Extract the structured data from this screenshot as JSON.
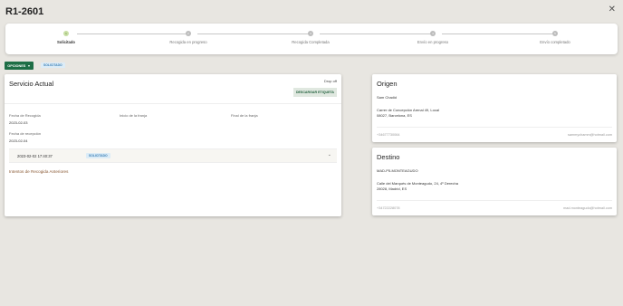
{
  "header": {
    "title": "R1-2601",
    "close_icon": "close-icon"
  },
  "stepper": {
    "steps": [
      {
        "num": "1",
        "label": "Solicitado",
        "active": true
      },
      {
        "num": "2",
        "label": "Recogida en progreso",
        "active": false
      },
      {
        "num": "3",
        "label": "Recogida Completada",
        "active": false
      },
      {
        "num": "4",
        "label": "Envío en progreso",
        "active": false
      },
      {
        "num": "5",
        "label": "Envío completado",
        "active": false
      }
    ]
  },
  "toolbar": {
    "options_label": "OPCIONES",
    "status_badge": "SOLICITADO"
  },
  "service": {
    "title": "Servicio Actual",
    "mode": "Drop off",
    "download_label": "DESCARGAR ETIQUETA",
    "fields": {
      "pickup_date_label": "Fecha de Recogida",
      "pickup_date_value": "2023-02-03",
      "start_label": "Inicio de la franja",
      "end_label": "Final de la franja",
      "reception_label": "Fecha de recepción",
      "reception_value": "2023-02-04"
    },
    "history": {
      "datetime": "2023-02-02 17:40:37",
      "status": "SOLICITADO"
    },
    "previous_attempts": "Intentos de Recogida Anteriores"
  },
  "origin": {
    "title": "Origen",
    "name": "Sam Chadid",
    "address1": "Carrer de Concepción Arenal 49, Local",
    "address2": "08027, Barcelona, ES",
    "phone": "+34677730064",
    "email": "sammychamm@hotmail.com"
  },
  "destination": {
    "title": "Destino",
    "name": "MAD-P5-MONTEAGUDO",
    "address1": "Calle del Marqués de Monteagudo, 24, 4º Derecha",
    "address2": "28028, Madrid, ES",
    "phone": "+34722228078",
    "email": "mad.monteagudo@hotmail.com"
  }
}
